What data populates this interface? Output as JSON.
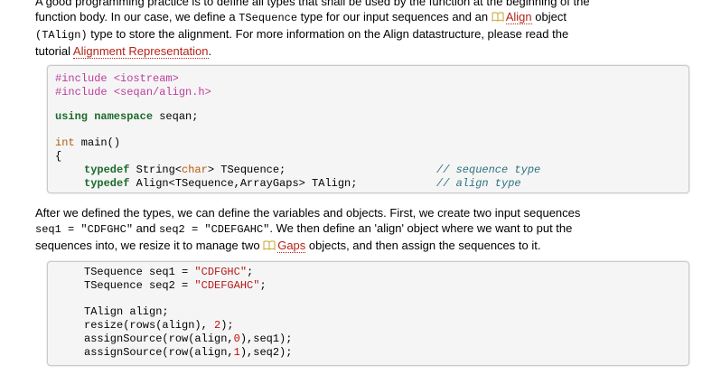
{
  "intro": {
    "line1": "A good programming practice is to define all types that shall be used by the function at the beginning of the",
    "line2_a": "function body. In our case, we define a ",
    "line2_code": "TSequence",
    "line2_b": " type for our input sequences and an ",
    "line2_link": "Align",
    "line2_c": " object",
    "line3_code": "(TAlign)",
    "line3_a": " type to store the alignment. For more information on the Align datastructure, please read the",
    "line4_a": "tutorial ",
    "line4_link": "Alignment Representation",
    "line4_b": "."
  },
  "code1": {
    "inc1_kw": "#include",
    "inc1_arg": "<iostream>",
    "inc2_kw": "#include",
    "inc2_arg": "<seqan/align.h>",
    "using_kw": "using namespace",
    "using_rest": " seqan;",
    "main_type": "int",
    "main_rest": " main()",
    "brace": "{",
    "td1_kw": "typedef",
    "td1_a": " String<",
    "td1_type": "char",
    "td1_b": "> TSequence;",
    "td1_comment": "// sequence type",
    "td2_kw": "typedef",
    "td2_a": " Align<TSequence,ArrayGaps> TAlign;",
    "td2_comment": "// align type"
  },
  "mid": {
    "line1": "After we defined the types, we can define the variables and objects. First, we create two input sequences",
    "line2_code1": "seq1",
    "line2_eq1": " = ",
    "line2_str1": "\"CDFGHC\"",
    "line2_and": " and ",
    "line2_code2": "seq2",
    "line2_eq2": " = ",
    "line2_str2": "\"CDEFGAHC\"",
    "line2_rest": ". We then define an 'align' object where we want to put the",
    "line3_a": "sequences into, we resize it to manage two ",
    "line3_link": "Gaps",
    "line3_b": " objects, and then assign the sequences to it."
  },
  "code2": {
    "l1_a": "TSequence seq1 = ",
    "l1_str": "\"CDFGHC\"",
    "l1_b": ";",
    "l2_a": "TSequence seq2 = ",
    "l2_str": "\"CDEFGAHC\"",
    "l2_b": ";",
    "l3": "TAlign align;",
    "l4_a": "resize(rows(align), ",
    "l4_num": "2",
    "l4_b": ");",
    "l5_a": "assignSource(row(align,",
    "l5_num": "0",
    "l5_b": "),seq1);",
    "l6_a": "assignSource(row(align,",
    "l6_num": "1",
    "l6_b": "),seq2);"
  },
  "colors": {
    "link": "#b42318",
    "keyword": "#1c6b2b",
    "preproc": "#bc3d9b",
    "comment": "#2c7282"
  },
  "icons": {
    "doc_link": "book-icon"
  }
}
